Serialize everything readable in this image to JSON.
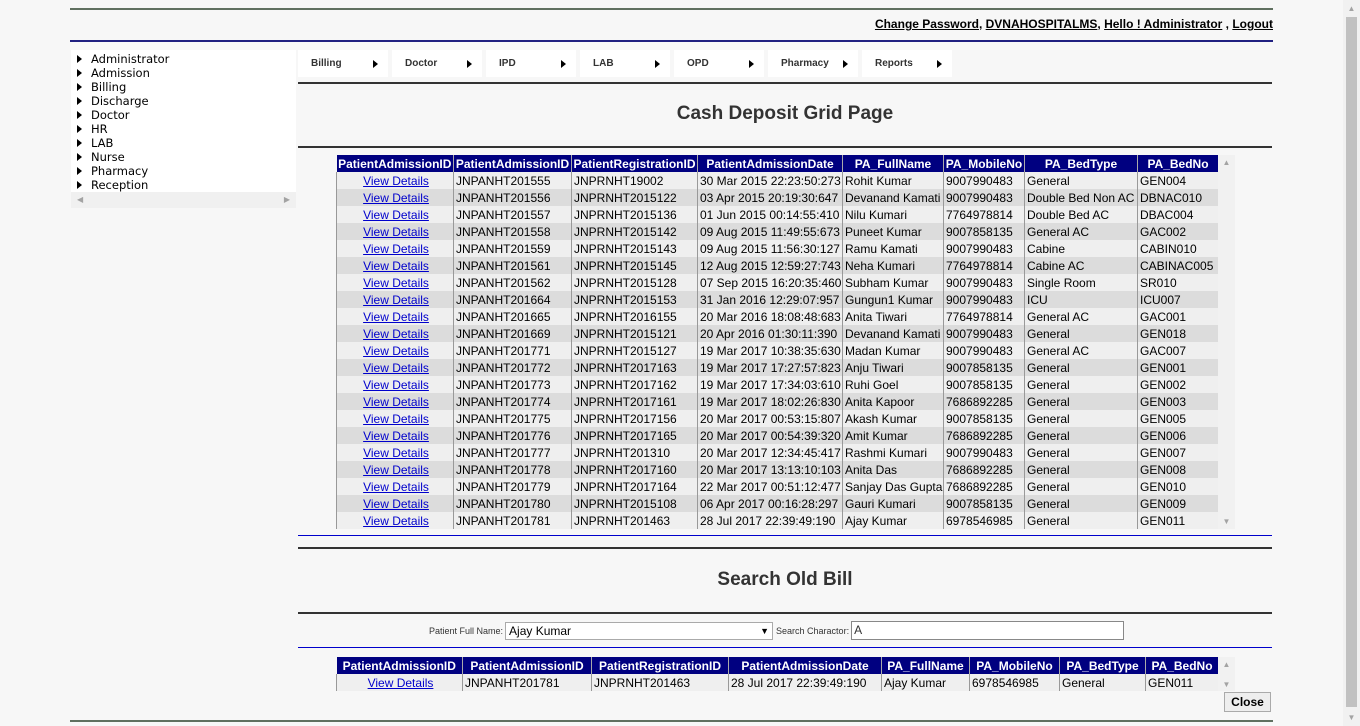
{
  "header": {
    "links": [
      "Change Password",
      "DVNAHOSPITALMS",
      "Hello ! Administrator",
      "Logout"
    ]
  },
  "sidebar": {
    "items": [
      "Administrator",
      "Admission",
      "Billing",
      "Discharge",
      "Doctor",
      "HR",
      "LAB",
      "Nurse",
      "Pharmacy",
      "Reception"
    ]
  },
  "menu": {
    "items": [
      "Billing",
      "Doctor",
      "IPD",
      "LAB",
      "OPD",
      "Pharmacy",
      "Reports"
    ]
  },
  "cash_grid": {
    "title": "Cash Deposit Grid Page",
    "columns": [
      "PatientAdmissionID",
      "PatientAdmissionID",
      "PatientRegistrationID",
      "PatientAdmissionDate",
      "PA_FullName",
      "PA_MobileNo",
      "PA_BedType",
      "PA_BedNo"
    ],
    "link_label": "View Details",
    "rows": [
      [
        "JNPANHT201555",
        "JNPRNHT19002",
        "30 Mar 2015 22:23:50:273",
        "Rohit Kumar",
        "9007990483",
        "General",
        "GEN004"
      ],
      [
        "JNPANHT201556",
        "JNPRNHT2015122",
        "03 Apr 2015 20:19:30:647",
        "Devanand Kamati",
        "9007990483",
        "Double Bed Non AC",
        "DBNAC010"
      ],
      [
        "JNPANHT201557",
        "JNPRNHT2015136",
        "01 Jun 2015 00:14:55:410",
        "Nilu Kumari",
        "7764978814",
        "Double Bed AC",
        "DBAC004"
      ],
      [
        "JNPANHT201558",
        "JNPRNHT2015142",
        "09 Aug 2015 11:49:55:673",
        "Puneet Kumar",
        "9007858135",
        "General AC",
        "GAC002"
      ],
      [
        "JNPANHT201559",
        "JNPRNHT2015143",
        "09 Aug 2015 11:56:30:127",
        "Ramu Kamati",
        "9007990483",
        "Cabine",
        "CABIN010"
      ],
      [
        "JNPANHT201561",
        "JNPRNHT2015145",
        "12 Aug 2015 12:59:27:743",
        "Neha Kumari",
        "7764978814",
        "Cabine AC",
        "CABINAC005"
      ],
      [
        "JNPANHT201562",
        "JNPRNHT2015128",
        "07 Sep 2015 16:20:35:460",
        "Subham Kumar",
        "9007990483",
        "Single Room",
        "SR010"
      ],
      [
        "JNPANHT201664",
        "JNPRNHT2015153",
        "31 Jan 2016 12:29:07:957",
        "Gungun1 Kumar",
        "9007990483",
        "ICU",
        "ICU007"
      ],
      [
        "JNPANHT201665",
        "JNPRNHT2016155",
        "20 Mar 2016 18:08:48:683",
        "Anita Tiwari",
        "7764978814",
        "General AC",
        "GAC001"
      ],
      [
        "JNPANHT201669",
        "JNPRNHT2015121",
        "20 Apr 2016 01:30:11:390",
        "Devanand Kamati",
        "9007990483",
        "General",
        "GEN018"
      ],
      [
        "JNPANHT201771",
        "JNPRNHT2015127",
        "19 Mar 2017 10:38:35:630",
        "Madan Kumar",
        "9007990483",
        "General AC",
        "GAC007"
      ],
      [
        "JNPANHT201772",
        "JNPRNHT2017163",
        "19 Mar 2017 17:27:57:823",
        "Anju Tiwari",
        "9007858135",
        "General",
        "GEN001"
      ],
      [
        "JNPANHT201773",
        "JNPRNHT2017162",
        "19 Mar 2017 17:34:03:610",
        "Ruhi Goel",
        "9007858135",
        "General",
        "GEN002"
      ],
      [
        "JNPANHT201774",
        "JNPRNHT2017161",
        "19 Mar 2017 18:02:26:830",
        "Anita Kapoor",
        "7686892285",
        "General",
        "GEN003"
      ],
      [
        "JNPANHT201775",
        "JNPRNHT2017156",
        "20 Mar 2017 00:53:15:807",
        "Akash Kumar",
        "9007858135",
        "General",
        "GEN005"
      ],
      [
        "JNPANHT201776",
        "JNPRNHT2017165",
        "20 Mar 2017 00:54:39:320",
        "Amit Kumar",
        "7686892285",
        "General",
        "GEN006"
      ],
      [
        "JNPANHT201777",
        "JNPRNHT201310",
        "20 Mar 2017 12:34:45:417",
        "Rashmi Kumari",
        "9007990483",
        "General",
        "GEN007"
      ],
      [
        "JNPANHT201778",
        "JNPRNHT2017160",
        "20 Mar 2017 13:13:10:103",
        "Anita Das",
        "7686892285",
        "General",
        "GEN008"
      ],
      [
        "JNPANHT201779",
        "JNPRNHT2017164",
        "22 Mar 2017 00:51:12:477",
        "Sanjay Das Gupta",
        "7686892285",
        "General",
        "GEN010"
      ],
      [
        "JNPANHT201780",
        "JNPRNHT2015108",
        "06 Apr 2017 00:16:28:297",
        "Gauri Kumari",
        "9007858135",
        "General",
        "GEN009"
      ],
      [
        "JNPANHT201781",
        "JNPRNHT201463",
        "28 Jul 2017 22:39:49:190",
        "Ajay Kumar",
        "6978546985",
        "General",
        "GEN011"
      ]
    ]
  },
  "search": {
    "title": "Search Old Bill",
    "name_label": "Patient Full Name:",
    "name_value": "Ajay Kumar",
    "char_label": "Search Charactor:",
    "char_value": "A"
  },
  "result_grid": {
    "columns": [
      "PatientAdmissionID",
      "PatientAdmissionID",
      "PatientRegistrationID",
      "PatientAdmissionDate",
      "PA_FullName",
      "PA_MobileNo",
      "PA_BedType",
      "PA_BedNo"
    ],
    "link_label": "View Details",
    "rows": [
      [
        "JNPANHT201781",
        "JNPRNHT201463",
        "28 Jul 2017 22:39:49:190",
        "Ajay Kumar",
        "6978546985",
        "General",
        "GEN011"
      ]
    ]
  },
  "close_label": "Close",
  "colors": {
    "header_bg": "#000080",
    "link": "#0000cc",
    "rule_blue": "#0000cc"
  }
}
